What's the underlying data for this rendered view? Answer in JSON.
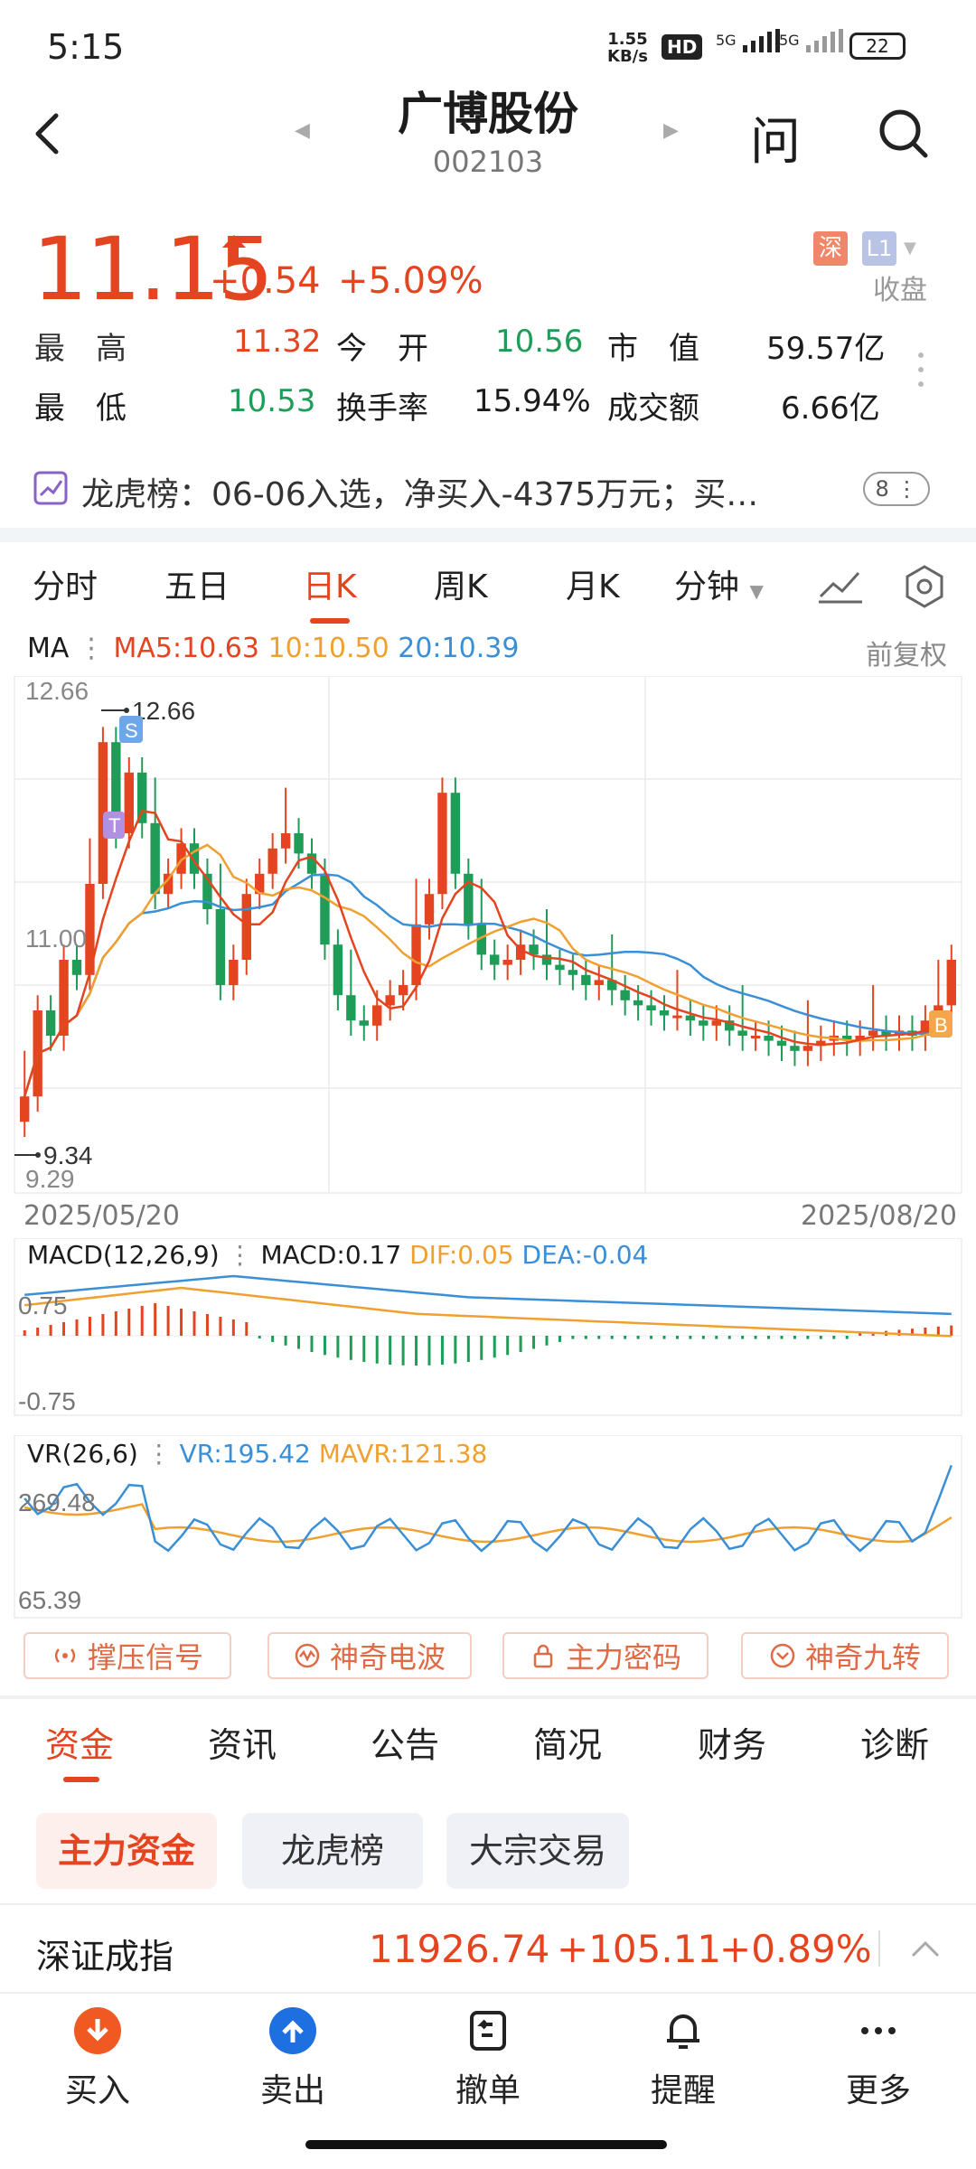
{
  "status_bar": {
    "time": "5:15",
    "net_speed_value": "1.55",
    "net_speed_unit": "KB/s",
    "hd_label": "HD",
    "sig1": "5G",
    "sig2": "5G",
    "battery": "22"
  },
  "header": {
    "title": "广博股份",
    "code": "002103",
    "ask_label": "问"
  },
  "quote": {
    "price": "11.15",
    "change": "+0.54",
    "change_pct": "+5.09%",
    "exchange_badge": "深",
    "level_badge": "L1",
    "status": "收盘",
    "high_label": "最　高",
    "high": "11.32",
    "open_label": "今　开",
    "open": "10.56",
    "mktcap_label": "市　值",
    "mktcap": "59.57亿",
    "low_label": "最　低",
    "low": "10.53",
    "turnover_label": "换手率",
    "turnover": "15.94%",
    "amount_label": "成交额",
    "amount": "6.66亿"
  },
  "lhb_banner": {
    "text": "龙虎榜：06-06入选，净买入-4375万元；买…",
    "count": "8"
  },
  "period_tabs": [
    "分时",
    "五日",
    "日K",
    "周K",
    "月K",
    "分钟"
  ],
  "ma_legend": {
    "title": "MA",
    "ma5": "MA5:10.63",
    "ma10": "10:10.50",
    "ma20": "20:10.39",
    "adjust": "前复权"
  },
  "kline": {
    "y_top": "12.66",
    "y_mid": "11.00",
    "y_bottom": "9.29",
    "max_marker": "12.66",
    "min_marker": "9.34",
    "s_flag": "S",
    "t_flag": "T",
    "b_flag": "B",
    "date_start": "2025/05/20",
    "date_end": "2025/08/20"
  },
  "macd": {
    "title": "MACD(12,26,9)",
    "macd": "MACD:0.17",
    "dif": "DIF:0.05",
    "dea": "DEA:-0.04",
    "y_top": "0.75",
    "y_bottom": "-0.75"
  },
  "vr": {
    "title": "VR(26,6)",
    "vr": "VR:195.42",
    "mavr": "MAVR:121.38",
    "y_top": "269.48",
    "y_bottom": "65.39"
  },
  "indicator_buttons": [
    "撑压信号",
    "神奇电波",
    "主力密码",
    "神奇九转"
  ],
  "section_tabs": [
    "资金",
    "资讯",
    "公告",
    "简况",
    "财务",
    "诊断"
  ],
  "chips": [
    "主力资金",
    "龙虎榜",
    "大宗交易"
  ],
  "index": {
    "name": "深证成指",
    "value": "11926.74",
    "change": "+105.11",
    "pct": "+0.89%"
  },
  "bottom_bar": [
    "买入",
    "卖出",
    "撤单",
    "提醒",
    "更多"
  ],
  "colors": {
    "up": "#e4441f",
    "down": "#1f9c57",
    "ma5": "#e4441f",
    "ma10": "#f0a030",
    "ma20": "#3a8fd6",
    "buy_icon": "#f05a22",
    "sell_icon": "#1e6fe0"
  },
  "icons": {
    "back": "chevron-left-icon",
    "search": "search-icon",
    "up_arrow": "up-arrow-icon",
    "more": "more-dots-icon"
  }
}
